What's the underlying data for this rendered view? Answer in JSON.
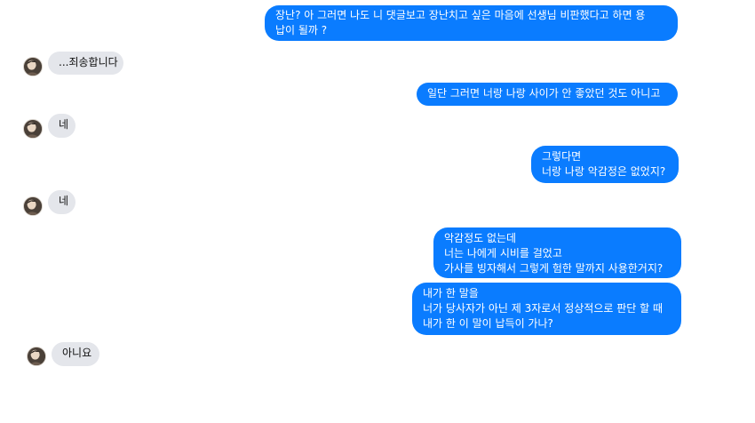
{
  "messages": [
    {
      "side": "out",
      "lines": [
        "장난? 아 그러면 나도 니 댓글보고 장난치고 싶은 마음에 선생님 비판했다고 하면 용",
        "납이 될까 ?"
      ]
    },
    {
      "side": "in",
      "lines": [
        "...죄송합니다"
      ]
    },
    {
      "side": "out",
      "lines": [
        "일단 그러면 너랑 나랑 사이가 안 좋았던 것도 아니고"
      ]
    },
    {
      "side": "in",
      "lines": [
        "네"
      ]
    },
    {
      "side": "out",
      "lines": [
        "그렇다면",
        "너랑 나랑 악감정은 없었지?"
      ]
    },
    {
      "side": "in",
      "lines": [
        "네"
      ]
    },
    {
      "side": "out",
      "lines": [
        "악감정도 없는데",
        "너는 나에게 시비를 걸었고",
        "가사를 빙자해서 그렇게 험한 말까지 사용한거지?"
      ]
    },
    {
      "side": "out",
      "lines": [
        "내가 한 말을",
        "너가 당사자가 아닌 제 3자로서 정상적으로 판단 할 때",
        "내가 한 이 말이 납득이 가나?"
      ]
    },
    {
      "side": "in",
      "lines": [
        "아니요"
      ]
    }
  ],
  "colors": {
    "outgoing_bubble": "#0a7cff",
    "incoming_bubble": "#e4e6eb"
  }
}
